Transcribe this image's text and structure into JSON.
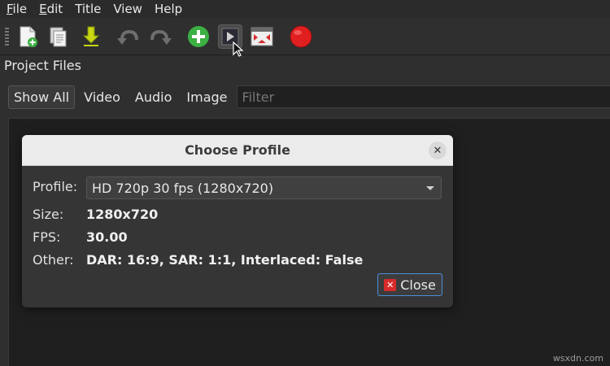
{
  "menubar": {
    "items": [
      {
        "label": "File",
        "mnemonic": "F",
        "rest": "ile"
      },
      {
        "label": "Edit",
        "mnemonic": "E",
        "rest": "dit"
      },
      {
        "label": "Title",
        "mnemonic": "",
        "rest": "Title"
      },
      {
        "label": "View",
        "mnemonic": "",
        "rest": "View"
      },
      {
        "label": "Help",
        "mnemonic": "",
        "rest": "Help"
      }
    ]
  },
  "toolbar": {
    "icons": [
      "new-project-icon",
      "open-project-icon",
      "save-project-icon",
      "undo-icon",
      "redo-icon",
      "import-files-icon",
      "choose-profile-icon",
      "fullscreen-icon",
      "export-video-icon"
    ],
    "colors": {
      "accent_blue": "#4a90d9",
      "record_red": "#e02020",
      "add_green": "#3cb043",
      "save_yellow": "#c8d614"
    }
  },
  "project_files": {
    "title": "Project Files",
    "filters": [
      "Show All",
      "Video",
      "Audio",
      "Image"
    ],
    "selected_filter": "Show All",
    "filter_placeholder": "Filter"
  },
  "dialog": {
    "title": "Choose Profile",
    "profile_label": "Profile:",
    "profile_value": "HD 720p 30 fps (1280x720)",
    "size_label": "Size:",
    "size_value": "1280x720",
    "fps_label": "FPS:",
    "fps_value": "30.00",
    "other_label": "Other:",
    "other_value": "DAR: 16:9, SAR: 1:1, Interlaced: False",
    "close_button_label": "Close"
  },
  "watermark": "wsxdn.com"
}
